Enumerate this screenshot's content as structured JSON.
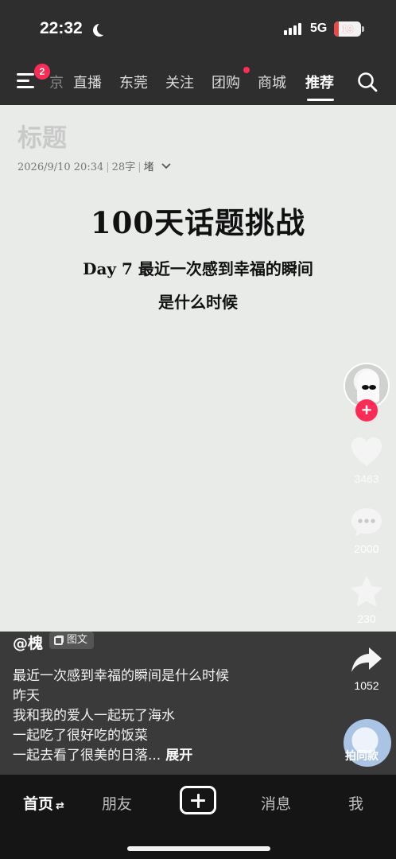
{
  "status_bar": {
    "time": "22:32",
    "network": "5G",
    "battery": "19"
  },
  "top_nav": {
    "menu_badge": "2",
    "tabs": [
      "京",
      "直播",
      "东莞",
      "关注",
      "团购",
      "商城",
      "推荐"
    ],
    "active_tab": "推荐"
  },
  "post": {
    "doc_title": "标题",
    "meta_date": "2026/9/10 20:34",
    "meta_chars": "28字",
    "meta_font": "堵",
    "headline": "100天话题挑战",
    "subline_1": "Day 7  最近一次感到幸福的瞬间",
    "subline_2": "是什么时候"
  },
  "rail": {
    "likes": "3463",
    "comments": "2000",
    "favorites": "230",
    "shares": "1052",
    "same_style_label": "拍同款"
  },
  "caption": {
    "author": "@槐",
    "type_label": "图文",
    "lines": [
      "最近一次感到幸福的瞬间是什么时候",
      "昨天",
      "我和我的爱人一起玩了海水",
      "一起吃了很好吃的饭菜",
      "一起去看了很美的日落..."
    ],
    "expand_label": "展开"
  },
  "bottom_nav": {
    "home": "首页",
    "friends": "朋友",
    "messages": "消息",
    "me": "我"
  },
  "colors": {
    "accent": "#fe2c55",
    "card_bg": "#e9ebe9",
    "nav_bg": "#2e2e2e"
  }
}
